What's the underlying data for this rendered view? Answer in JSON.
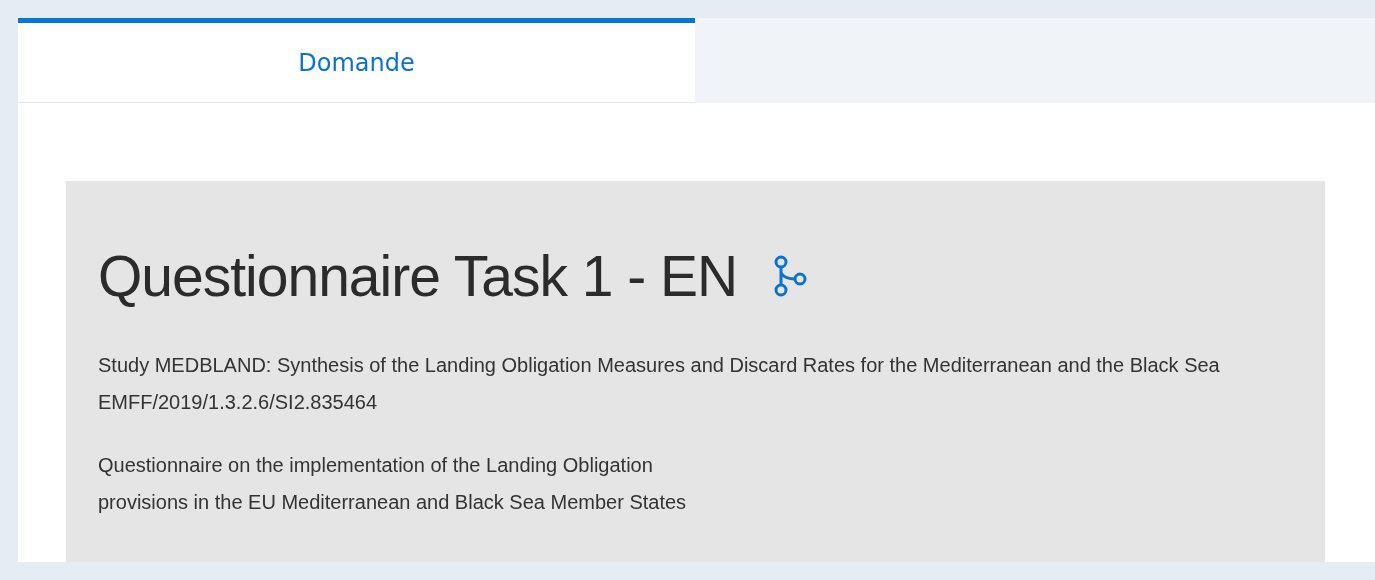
{
  "tabs": [
    {
      "label": "Domande",
      "selected": true
    }
  ],
  "survey": {
    "title": "Questionnaire Task 1 - EN",
    "paragraphs": [
      [
        "Study MEDBLAND: Synthesis of the Landing Obligation Measures and Discard Rates for the Mediterranean and the Black Sea EMFF/2019/1.3.2.6/SI2.835464"
      ],
      [
        "Questionnaire on the implementation of the Landing Obligation",
        "provisions in the EU Mediterranean and Black Sea Member States"
      ]
    ]
  }
}
